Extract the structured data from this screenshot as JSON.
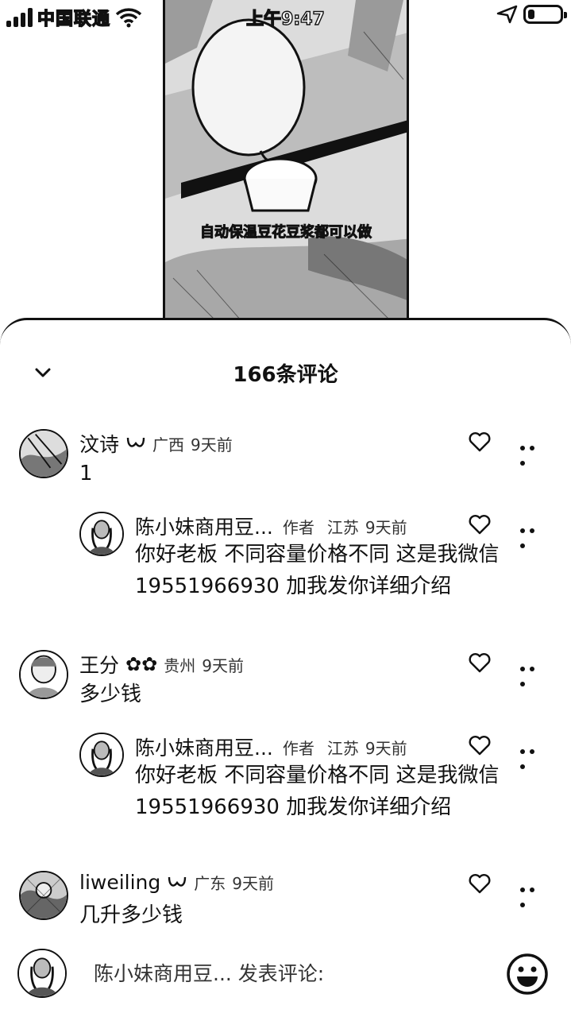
{
  "status_bar": {
    "carrier": "中国联通",
    "time": "上午9:47"
  },
  "video": {
    "subtitle": "自动保温豆花豆浆都可以做"
  },
  "sheet": {
    "title": "166条评论"
  },
  "comments": [
    {
      "name": "汶诗",
      "region": "广西",
      "time": "9天前",
      "text": "1",
      "replies": [
        {
          "name": "陈小妹商用豆...",
          "author_tag": "作者",
          "region": "江苏",
          "time": "9天前",
          "text_line1": "你好老板 不同容量价格不同 这是我微信",
          "text_line2": "19551966930  加我发你详细介绍"
        }
      ]
    },
    {
      "name": "王分",
      "region": "贵州",
      "time": "9天前",
      "text": "多少钱",
      "replies": [
        {
          "name": "陈小妹商用豆...",
          "author_tag": "作者",
          "region": "江苏",
          "time": "9天前",
          "text_line1": "你好老板 不同容量价格不同 这是我微信",
          "text_line2": "19551966930  加我发你详细介绍"
        }
      ]
    },
    {
      "name": "liweiling",
      "region": "广东",
      "time": "9天前",
      "text": "几升多少钱"
    }
  ],
  "input_bar": {
    "placeholder": "陈小妹商用豆... 发表评论:"
  },
  "icons": {
    "collapse": "chevron-down-icon",
    "like": "heart-outline-icon",
    "more": "more-dots-icon",
    "emoji": "emoji-smile-icon",
    "signal": "signal-bars-icon",
    "wifi": "wifi-icon",
    "battery": "battery-icon"
  }
}
